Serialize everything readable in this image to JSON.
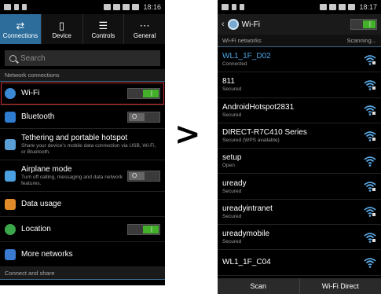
{
  "left_screen": {
    "status_time": "18:16",
    "tabs": [
      {
        "label": "Connections",
        "icon": "arrows-icon"
      },
      {
        "label": "Device",
        "icon": "phone-icon"
      },
      {
        "label": "Controls",
        "icon": "sliders-icon"
      },
      {
        "label": "General",
        "icon": "more-dots-icon"
      }
    ],
    "search_placeholder": "Search",
    "section_network": "Network connections",
    "items": [
      {
        "title": "Wi-Fi",
        "subtitle": "",
        "toggle": "on"
      },
      {
        "title": "Bluetooth",
        "subtitle": "",
        "toggle": "off"
      },
      {
        "title": "Tethering and portable hotspot",
        "subtitle": "Share your device's mobile data connection via USB, Wi-Fi, or Bluetooth.",
        "toggle": null
      },
      {
        "title": "Airplane mode",
        "subtitle": "Turn off calling, messaging and data network features.",
        "toggle": "off"
      },
      {
        "title": "Data usage",
        "subtitle": "",
        "toggle": null
      },
      {
        "title": "Location",
        "subtitle": "",
        "toggle": "on"
      },
      {
        "title": "More networks",
        "subtitle": "",
        "toggle": null
      }
    ],
    "section_connect": "Connect and share"
  },
  "arrow_symbol": ">",
  "right_screen": {
    "status_time": "18:17",
    "title": "Wi-Fi",
    "networks_header": "Wi-Fi networks",
    "scanning": "Scanning...",
    "networks": [
      {
        "name": "WL1_1F_D02",
        "status": "Connected"
      },
      {
        "name": "811",
        "status": "Secured"
      },
      {
        "name": "AndroidHotspot2831",
        "status": "Secured"
      },
      {
        "name": "DIRECT-R7C410 Series",
        "status": "Secured (WPS available)"
      },
      {
        "name": "setup",
        "status": "Open"
      },
      {
        "name": "uready",
        "status": "Secured"
      },
      {
        "name": "ureadyintranet",
        "status": "Secured"
      },
      {
        "name": "ureadymobile",
        "status": "Secured"
      },
      {
        "name": "WL1_1F_C04",
        "status": ""
      }
    ],
    "scan_label": "Scan",
    "wifi_direct_label": "Wi-Fi Direct"
  },
  "colors": {
    "accent_blue": "#2d6d9c",
    "toggle_on": "#43b02a",
    "highlight_red": "#d12a2a"
  }
}
